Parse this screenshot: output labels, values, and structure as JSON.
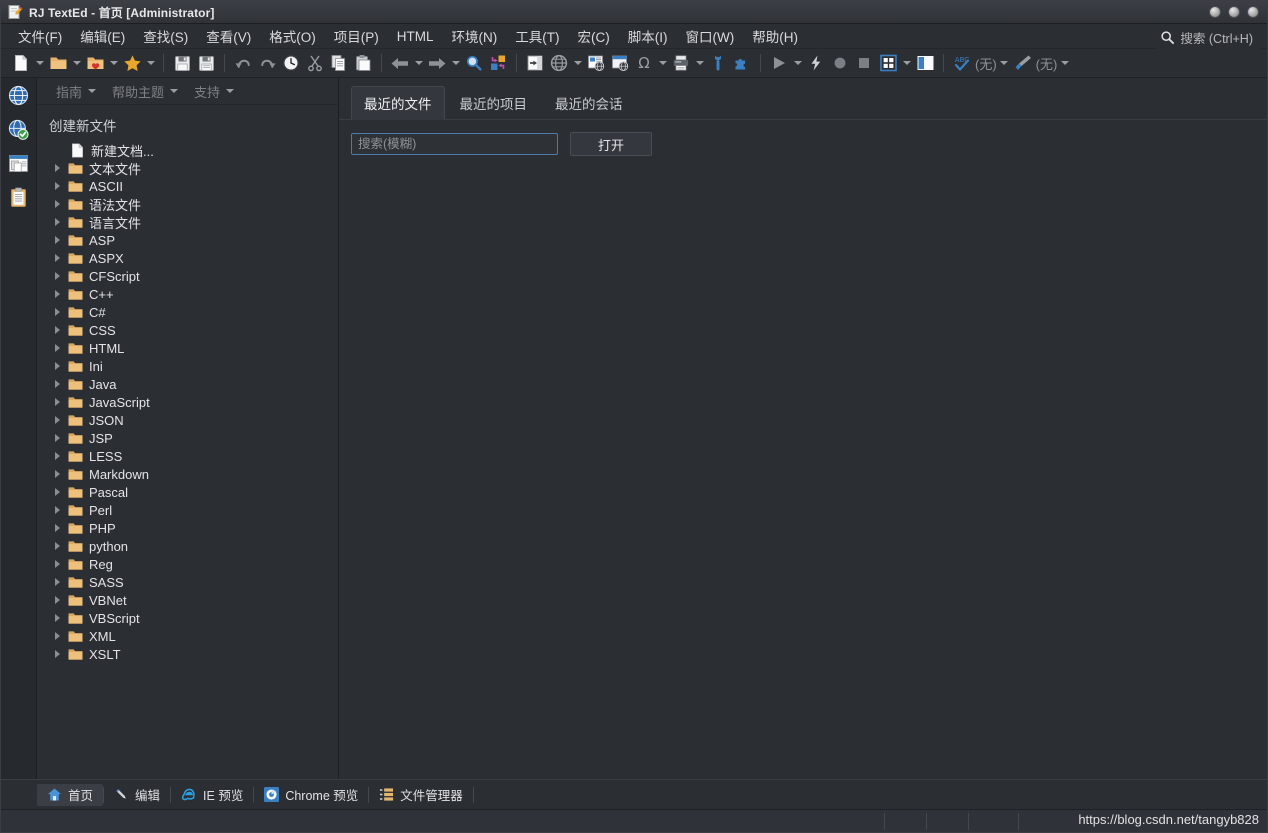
{
  "window": {
    "title": "RJ TextEd - 首页 [Administrator]",
    "app_icon": "notepad-pencil-icon",
    "controls": [
      "minimize-button",
      "maximize-button",
      "close-button"
    ]
  },
  "menubar": {
    "items": [
      {
        "label": "文件(F)",
        "mnemonic": "F"
      },
      {
        "label": "编辑(E)",
        "mnemonic": "E"
      },
      {
        "label": "查找(S)",
        "mnemonic": "S"
      },
      {
        "label": "查看(V)",
        "mnemonic": "V"
      },
      {
        "label": "格式(O)",
        "mnemonic": "O"
      },
      {
        "label": "项目(P)",
        "mnemonic": "P"
      },
      {
        "label": "HTML",
        "mnemonic": "M"
      },
      {
        "label": "环境(N)",
        "mnemonic": "N"
      },
      {
        "label": "工具(T)",
        "mnemonic": "T"
      },
      {
        "label": "宏(C)",
        "mnemonic": "C"
      },
      {
        "label": "脚本(I)",
        "mnemonic": "I"
      },
      {
        "label": "窗口(W)",
        "mnemonic": "W"
      },
      {
        "label": "帮助(H)",
        "mnemonic": "H"
      }
    ],
    "search": {
      "icon": "search-icon",
      "placeholder": "搜索 (Ctrl+H)"
    }
  },
  "toolbar": {
    "items": [
      {
        "icon": "new-file-icon",
        "caret": true
      },
      {
        "icon": "open-folder-icon",
        "caret": true
      },
      {
        "icon": "favorites-folder-icon",
        "caret": true
      },
      {
        "icon": "star-icon",
        "caret": true
      },
      {
        "sep": true
      },
      {
        "icon": "save-icon",
        "caret": false
      },
      {
        "icon": "save-all-icon",
        "caret": false
      },
      {
        "sep": true
      },
      {
        "icon": "undo-icon",
        "caret": false
      },
      {
        "icon": "redo-icon",
        "caret": false
      },
      {
        "icon": "history-icon",
        "caret": false
      },
      {
        "icon": "cut-icon",
        "caret": false
      },
      {
        "icon": "copy-icon",
        "caret": false
      },
      {
        "icon": "paste-icon",
        "caret": false
      },
      {
        "sep": true
      },
      {
        "icon": "back-arrow-icon",
        "caret": true
      },
      {
        "icon": "forward-arrow-icon",
        "caret": true
      },
      {
        "icon": "zoom-search-icon",
        "caret": false
      },
      {
        "icon": "replace-icon",
        "caret": false
      },
      {
        "sep": true
      },
      {
        "icon": "insert-icon",
        "caret": false
      },
      {
        "icon": "globe-icon",
        "caret": true
      },
      {
        "icon": "web-page-icon",
        "caret": false
      },
      {
        "icon": "browser-preview-icon",
        "caret": false
      },
      {
        "icon": "omega-symbol-icon",
        "caret": true
      },
      {
        "icon": "print-icon",
        "caret": true
      },
      {
        "icon": "wrench-icon",
        "caret": false
      },
      {
        "icon": "puzzle-icon",
        "caret": false
      },
      {
        "sep": true
      },
      {
        "icon": "play-icon",
        "caret": true
      },
      {
        "icon": "lightning-icon",
        "caret": false
      },
      {
        "icon": "record-icon",
        "caret": false
      },
      {
        "icon": "stop-icon",
        "caret": false
      },
      {
        "icon": "grid-view-icon",
        "caret": true
      },
      {
        "icon": "split-view-icon",
        "caret": false
      },
      {
        "sep": true
      },
      {
        "icon": "spellcheck-icon",
        "label": "(无)",
        "caret": true
      },
      {
        "icon": "brush-icon",
        "label": "(无)",
        "caret": true
      }
    ],
    "spell_label": "(无)",
    "theme_label": "(无)"
  },
  "rail": {
    "items": [
      {
        "icon": "globe-icon",
        "name": "web-tools"
      },
      {
        "icon": "globe-check-icon",
        "name": "validator"
      },
      {
        "icon": "snippets-window-icon",
        "name": "snippets"
      },
      {
        "icon": "clipboard-icon",
        "name": "clipboard-history"
      }
    ]
  },
  "sidebar": {
    "helpbar": [
      {
        "label": "指南",
        "caret": true
      },
      {
        "label": "帮助主题",
        "caret": true
      },
      {
        "label": "支持",
        "caret": true
      }
    ],
    "section_title": "创建新文件",
    "tree": [
      {
        "label": "新建文档...",
        "icon": "document-icon",
        "expandable": false
      },
      {
        "label": "文本文件",
        "icon": "folder-icon",
        "expandable": true
      },
      {
        "label": "ASCII",
        "icon": "folder-icon",
        "expandable": true
      },
      {
        "label": "语法文件",
        "icon": "folder-icon",
        "expandable": true
      },
      {
        "label": "语言文件",
        "icon": "folder-icon",
        "expandable": true
      },
      {
        "label": "ASP",
        "icon": "folder-icon",
        "expandable": true
      },
      {
        "label": "ASPX",
        "icon": "folder-icon",
        "expandable": true
      },
      {
        "label": "CFScript",
        "icon": "folder-icon",
        "expandable": true
      },
      {
        "label": "C++",
        "icon": "folder-icon",
        "expandable": true
      },
      {
        "label": "C#",
        "icon": "folder-icon",
        "expandable": true
      },
      {
        "label": "CSS",
        "icon": "folder-icon",
        "expandable": true
      },
      {
        "label": "HTML",
        "icon": "folder-icon",
        "expandable": true
      },
      {
        "label": "Ini",
        "icon": "folder-icon",
        "expandable": true
      },
      {
        "label": "Java",
        "icon": "folder-icon",
        "expandable": true
      },
      {
        "label": "JavaScript",
        "icon": "folder-icon",
        "expandable": true
      },
      {
        "label": "JSON",
        "icon": "folder-icon",
        "expandable": true
      },
      {
        "label": "JSP",
        "icon": "folder-icon",
        "expandable": true
      },
      {
        "label": "LESS",
        "icon": "folder-icon",
        "expandable": true
      },
      {
        "label": "Markdown",
        "icon": "folder-icon",
        "expandable": true
      },
      {
        "label": "Pascal",
        "icon": "folder-icon",
        "expandable": true
      },
      {
        "label": "Perl",
        "icon": "folder-icon",
        "expandable": true
      },
      {
        "label": "PHP",
        "icon": "folder-icon",
        "expandable": true
      },
      {
        "label": "python",
        "icon": "folder-icon",
        "expandable": true
      },
      {
        "label": "Reg",
        "icon": "folder-icon",
        "expandable": true
      },
      {
        "label": "SASS",
        "icon": "folder-icon",
        "expandable": true
      },
      {
        "label": "VBNet",
        "icon": "folder-icon",
        "expandable": true
      },
      {
        "label": "VBScript",
        "icon": "folder-icon",
        "expandable": true
      },
      {
        "label": "XML",
        "icon": "folder-icon",
        "expandable": true
      },
      {
        "label": "XSLT",
        "icon": "folder-icon",
        "expandable": true
      }
    ]
  },
  "main": {
    "tabs": [
      {
        "label": "最近的文件",
        "active": true
      },
      {
        "label": "最近的项目",
        "active": false
      },
      {
        "label": "最近的会话",
        "active": false
      }
    ],
    "search": {
      "value": "",
      "placeholder": "搜索(模糊)"
    },
    "open_button": "打开"
  },
  "bottom_tabs": [
    {
      "label": "首页",
      "icon": "home-icon",
      "active": true
    },
    {
      "label": "编辑",
      "icon": "pencil-icon",
      "active": false
    },
    {
      "label": "IE 预览",
      "icon": "ie-icon",
      "active": false
    },
    {
      "label": "Chrome 预览",
      "icon": "chrome-icon",
      "active": false
    },
    {
      "label": "文件管理器",
      "icon": "file-manager-icon",
      "active": false
    }
  ],
  "statusbar": {
    "watermark": "https://blog.csdn.net/tangyb828"
  },
  "colors": {
    "window_bg": "#2b2e33",
    "titlebar": "#3c3f45",
    "accent_blue": "#4e7aa8",
    "folder_yellow": "#e3b670",
    "text": "#e2e4e7",
    "muted_text": "#8e9195"
  }
}
